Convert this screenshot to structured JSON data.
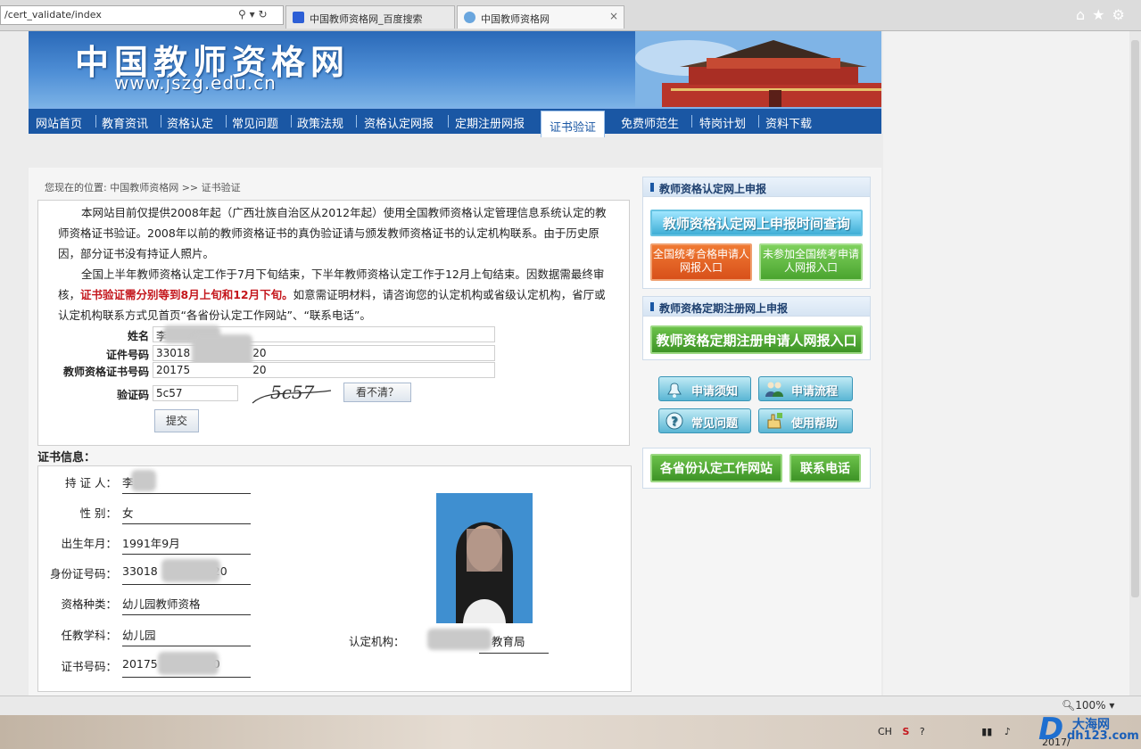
{
  "browser": {
    "address": "/cert_validate/index",
    "tabs": [
      {
        "label": "中国教师资格网_百度搜索"
      },
      {
        "label": "中国教师资格网"
      }
    ],
    "close_glyph": "×",
    "zoom": "100%"
  },
  "site": {
    "logo_text": "中国教师资格网",
    "logo_url": "www.jszg.edu.cn"
  },
  "nav": [
    "网站首页",
    "教育资讯",
    "资格认定",
    "常见问题",
    "政策法规",
    "资格认定网报",
    "定期注册网报",
    "证书验证",
    "免费师范生",
    "特岗计划",
    "资料下载"
  ],
  "breadcrumb": "您现在的位置: 中国教师资格网 >> 证书验证",
  "notice": {
    "p1": "本网站目前仅提供2008年起（广西壮族自治区从2012年起）使用全国教师资格认定管理信息系统认定的教师资格证书验证。2008年以前的教师资格证书的真伪验证请与颁发教师资格证书的认定机构联系。由于历史原因，部分证书没有持证人照片。",
    "p2_a": "全国上半年教师资格认定工作于7月下旬结束，下半年教师资格认定工作于12月上旬结束。因数据需最终审核，",
    "p2_red": "证书验证需分别等到8月上旬和12月下旬。",
    "p2_b": "如意需证明材料，请咨询您的认定机构或省级认定机构，省厅或认定机构联系方式见首页“各省份认定工作网站”、“联系电话”。"
  },
  "form": {
    "name_label": "姓名",
    "name_value": "李",
    "id_label": "证件号码",
    "id_value_start": "33018",
    "id_value_end": "20",
    "cert_label": "教师资格证书号码",
    "cert_value_start": "20175",
    "cert_value_end": "20",
    "captcha_label": "验证码",
    "captcha_value": "5c57",
    "captcha_image_text": "5c57",
    "refresh_label": "看不清？",
    "submit_label": "提交"
  },
  "cert": {
    "title": "证书信息：",
    "holder_label": "持 证 人：",
    "holder_value": "李",
    "gender_label": "性    别：",
    "gender_value": "女",
    "birth_label": "出生年月：",
    "birth_value": "1991年9月",
    "idno_label": "身份证号码：",
    "idno_start": "33018",
    "idno_end": "20",
    "type_label": "资格种类：",
    "type_value": "幼儿园教师资格",
    "subject_label": "任教学科：",
    "subject_value": "幼儿园",
    "certno_label": "证书号码：",
    "certno_start": "20175",
    "certno_end": "0",
    "authority_label": "认定机构：",
    "authority_value": "教育局"
  },
  "sidebar": {
    "apply_head": "教师资格认定网上申报",
    "apply_time_btn": "教师资格认定网上申报时间查询",
    "exam_pass_btn": "全国统考合格申请人网报入口",
    "no_exam_btn": "未参加全国统考申请人网报入口",
    "register_head": "教师资格定期注册网上申报",
    "register_btn": "教师资格定期注册申请人网报入口",
    "icons": [
      {
        "label": "申请须知",
        "icon": "bell-icon"
      },
      {
        "label": "申请流程",
        "icon": "people-icon"
      },
      {
        "label": "常见问题",
        "icon": "question-icon"
      },
      {
        "label": "使用帮助",
        "icon": "help-hand-icon"
      }
    ],
    "province_btn": "各省份认定工作网站",
    "contact_btn": "联系电话"
  },
  "taskbar": {
    "lang": "CH",
    "year_partial": "2017/"
  },
  "watermark": {
    "letter": "D",
    "name": "大海网",
    "domain": "dh123.com"
  },
  "colors": {
    "nav_bg": "#1a57a4",
    "red_notice": "#c4171d",
    "orange_btn": "#e8631a",
    "green_btn": "#57b23c"
  }
}
